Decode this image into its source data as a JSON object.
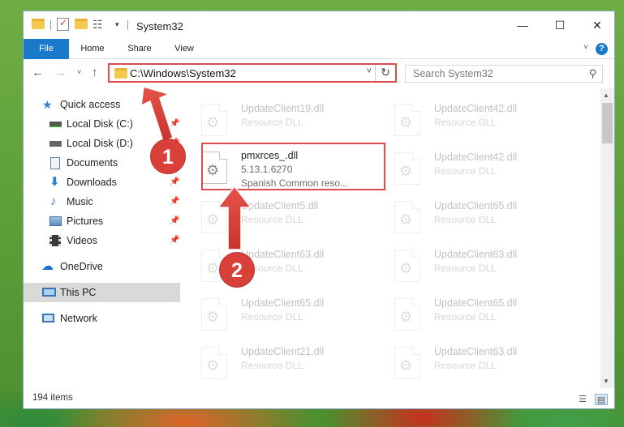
{
  "window": {
    "title": "System32",
    "minimize_glyph": "—",
    "maximize_glyph": "☐",
    "close_glyph": "✕"
  },
  "ribbon": {
    "tabs": [
      "File",
      "Home",
      "Share",
      "View"
    ],
    "help": "?"
  },
  "address": {
    "path": "C:\\Windows\\System32",
    "search_placeholder": "Search System32"
  },
  "nav": {
    "items": [
      {
        "label": "Quick access",
        "icon": "star-icon"
      },
      {
        "label": "Local Disk (C:)",
        "icon": "drive-icon",
        "pinned": true
      },
      {
        "label": "Local Disk (D:)",
        "icon": "drive-icon",
        "pinned": true
      },
      {
        "label": "Documents",
        "icon": "documents-icon",
        "pinned": true
      },
      {
        "label": "Downloads",
        "icon": "download-icon",
        "pinned": true
      },
      {
        "label": "Music",
        "icon": "music-icon",
        "pinned": true
      },
      {
        "label": "Pictures",
        "icon": "pictures-icon",
        "pinned": true
      },
      {
        "label": "Videos",
        "icon": "videos-icon",
        "pinned": true
      },
      {
        "label": "OneDrive",
        "icon": "cloud-icon"
      },
      {
        "label": "This PC",
        "icon": "computer-icon",
        "selected": true
      },
      {
        "label": "Network",
        "icon": "network-icon"
      }
    ]
  },
  "files": {
    "highlighted": {
      "name": "pmxrces_.dll",
      "version": "5.13.1.6270",
      "description": "Spanish Common reso..."
    },
    "left": [
      {
        "name": "UpdateClient19.dll",
        "type": "Resource DLL"
      },
      {
        "name": "UpdateClient5.dll",
        "type": "Resource DLL"
      },
      {
        "name": "UpdateClient63.dll",
        "type": "Resource DLL"
      },
      {
        "name": "UpdateClient65.dll",
        "type": "Resource DLL"
      },
      {
        "name": "UpdateClient21.dll",
        "type": "Resource DLL"
      }
    ],
    "right": [
      {
        "name": "UpdateClient42.dll",
        "type": "Resource DLL"
      },
      {
        "name": "UpdateClient42.dll",
        "type": "Resource DLL"
      },
      {
        "name": "UpdateClient65.dll",
        "type": "Resource DLL"
      },
      {
        "name": "UpdateClient63.dll",
        "type": "Resource DLL"
      },
      {
        "name": "UpdateClient65.dll",
        "type": "Resource DLL"
      },
      {
        "name": "UpdateClient63.dll",
        "type": "Resource DLL"
      }
    ]
  },
  "status": {
    "count": "194 items"
  },
  "annotations": {
    "step1": "1",
    "step2": "2",
    "color": "#d9403a"
  },
  "colors": {
    "accent": "#1979ca",
    "highlight": "#e04b4b",
    "selected_nav": "#d9d9d9"
  }
}
